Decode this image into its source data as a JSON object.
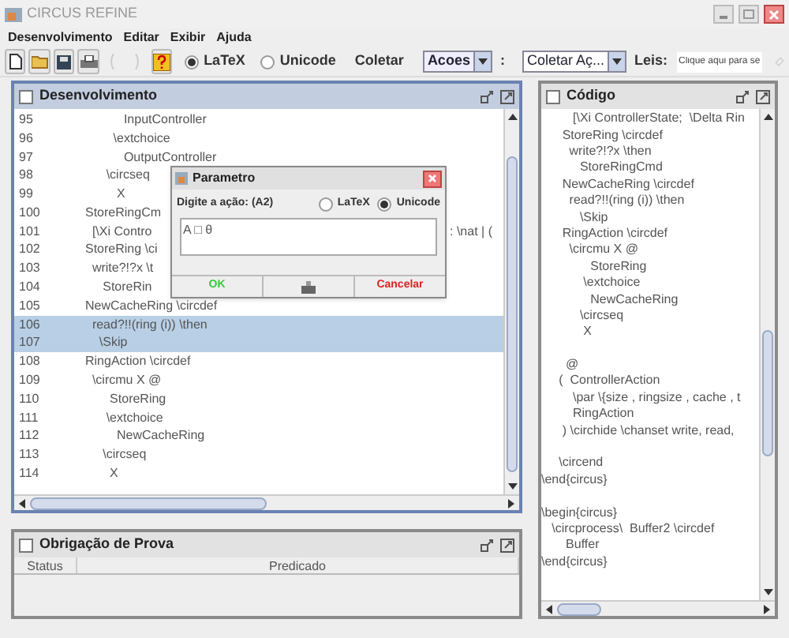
{
  "window": {
    "title": "CIRCUS REFINE",
    "active": false
  },
  "menu": [
    "Desenvolvimento",
    "Editar",
    "Exibir",
    "Ajuda"
  ],
  "toolbar": {
    "notation": [
      {
        "label": "LaTeX",
        "selected": true
      },
      {
        "label": "Unicode",
        "selected": false
      }
    ],
    "collect_label": "Coletar",
    "actions_combo": "Acoes",
    "separator": ":",
    "collect_combo": "Coletar Aç...",
    "laws_label": "Leis:",
    "laws_placeholder": "Clique aqui para se"
  },
  "editor": {
    "title": "Desenvolvimento",
    "active": true,
    "lines": [
      {
        "number": "95",
        "text": "           InputController",
        "selected": false
      },
      {
        "number": "96",
        "text": "        \\extchoice",
        "selected": false
      },
      {
        "number": "97",
        "text": "           OutputController",
        "selected": false
      },
      {
        "number": "98",
        "text": "      \\circseq",
        "selected": false
      },
      {
        "number": "99",
        "text": "         X",
        "selected": false
      },
      {
        "number": "100",
        "text": "StoreRingCm",
        "selected": false
      },
      {
        "number": "101",
        "text": "  [\\Xi Contro",
        "tail": ": \\nat | (",
        "selected": false
      },
      {
        "number": "102",
        "text": "StoreRing \\ci",
        "selected": false
      },
      {
        "number": "103",
        "text": "  write?!?x \\t",
        "selected": false
      },
      {
        "number": "104",
        "text": "     StoreRin",
        "selected": false
      },
      {
        "number": "105",
        "text": "NewCacheRing \\circdef",
        "selected": false
      },
      {
        "number": "106",
        "text": "  read?!!(ring (i)) \\then",
        "selected": true
      },
      {
        "number": "107",
        "text": "    \\Skip",
        "selected": true
      },
      {
        "number": "108",
        "text": "RingAction \\circdef",
        "selected": false
      },
      {
        "number": "109",
        "text": "  \\circmu X @",
        "selected": false
      },
      {
        "number": "110",
        "text": "       StoreRing",
        "selected": false
      },
      {
        "number": "111",
        "text": "      \\extchoice",
        "selected": false
      },
      {
        "number": "112",
        "text": "         NewCacheRing",
        "selected": false
      },
      {
        "number": "113",
        "text": "     \\circseq",
        "selected": false
      },
      {
        "number": "114",
        "text": "       X",
        "selected": false
      }
    ]
  },
  "proof": {
    "title": "Obrigação de Prova",
    "active": false,
    "columns": [
      "Status",
      "Predicado"
    ]
  },
  "code": {
    "title": "Código",
    "active": false,
    "lines": [
      {
        "kind": "text",
        "text": "         [\\Xi ControllerState;  \\Delta Rin"
      },
      {
        "kind": "text",
        "text": "      StoreRing \\circdef"
      },
      {
        "kind": "text",
        "text": "        write?!?x \\then"
      },
      {
        "kind": "text",
        "text": "           StoreRingCmd"
      },
      {
        "kind": "text",
        "text": "      NewCacheRing \\circdef"
      },
      {
        "kind": "text",
        "text": "        read?!!(ring (i)) \\then"
      },
      {
        "kind": "text",
        "text": "           \\Skip"
      },
      {
        "kind": "text",
        "text": "      RingAction \\circdef"
      },
      {
        "kind": "text",
        "text": "        \\circmu X @"
      },
      {
        "kind": "text",
        "text": "              StoreRing"
      },
      {
        "kind": "text",
        "text": "            \\extchoice"
      },
      {
        "kind": "text",
        "text": "              NewCacheRing"
      },
      {
        "kind": "text",
        "text": "           \\circseq"
      },
      {
        "kind": "text",
        "text": "            X"
      },
      {
        "kind": "blank"
      },
      {
        "kind": "text",
        "text": "       @"
      },
      {
        "kind": "text",
        "text": "     (  ControllerAction"
      },
      {
        "kind": "text",
        "text": "         \\par \\{size , ringsize , cache , t"
      },
      {
        "kind": "text",
        "text": "         RingAction"
      },
      {
        "kind": "text",
        "text": "      ) \\circhide \\chanset write, read,"
      },
      {
        "kind": "blank"
      },
      {
        "kind": "text",
        "text": "     \\circend"
      },
      {
        "kind": "text",
        "text": "\\end{circus}"
      },
      {
        "kind": "blank"
      },
      {
        "kind": "text",
        "text": "\\begin{circus}"
      },
      {
        "kind": "text",
        "text": "   \\circprocess\\  Buffer2 \\circdef"
      },
      {
        "kind": "text",
        "text": "       Buffer"
      },
      {
        "kind": "text",
        "text": "\\end{circus}"
      }
    ]
  },
  "dialog": {
    "title": "Parametro",
    "prompt": "Digite a ação: (A2)",
    "notation": [
      {
        "label": "LaTeX",
        "selected": false
      },
      {
        "label": "Unicode",
        "selected": true
      }
    ],
    "value": "A □ θ",
    "ok": "OK",
    "cancel": "Cancelar"
  }
}
